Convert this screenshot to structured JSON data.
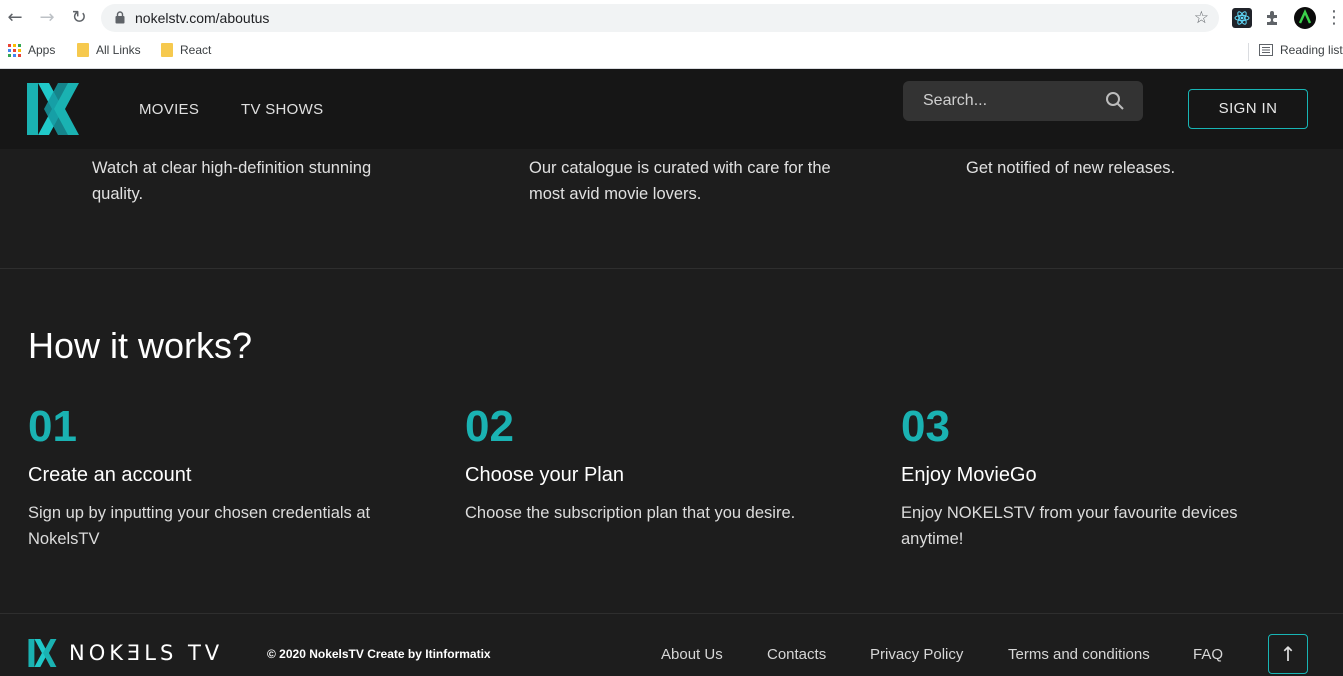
{
  "browser": {
    "url": "nokelstv.com/aboutus",
    "bookmarks": [
      {
        "label": "Apps",
        "icon": "apps-grid-icon"
      },
      {
        "label": "All Links",
        "icon": "folder-icon"
      },
      {
        "label": "React",
        "icon": "folder-icon"
      }
    ],
    "reading_list": "Reading list"
  },
  "header": {
    "nav": [
      "MOVIES",
      "TV SHOWS"
    ],
    "search_placeholder": "Search...",
    "sign_in": "SIGN IN"
  },
  "features": [
    {
      "text": "Watch at clear high-definition stunning quality."
    },
    {
      "text": "Our catalogue is curated with care for the most avid movie lovers."
    },
    {
      "text": "Get notified of new releases."
    }
  ],
  "how": {
    "title": "How it works?",
    "steps": [
      {
        "number": "01",
        "title": "Create an account",
        "desc": "Sign up by inputting your chosen credentials at NokelsTV"
      },
      {
        "number": "02",
        "title": "Choose your Plan",
        "desc": "Choose the subscription plan that you desire."
      },
      {
        "number": "03",
        "title": "Enjoy MovieGo",
        "desc": "Enjoy NOKELSTV from your favourite devices anytime!"
      }
    ]
  },
  "footer": {
    "brand": "NOKƎLS TV",
    "copyright": "© 2020 NokelsTV Create by Itinformatix",
    "links": [
      "About Us",
      "Contacts",
      "Privacy Policy",
      "Terms and conditions",
      "FAQ"
    ],
    "to_top": "↑"
  },
  "colors": {
    "accent": "#1ab2b2",
    "background": "#1d1d1d",
    "header": "#161616"
  }
}
